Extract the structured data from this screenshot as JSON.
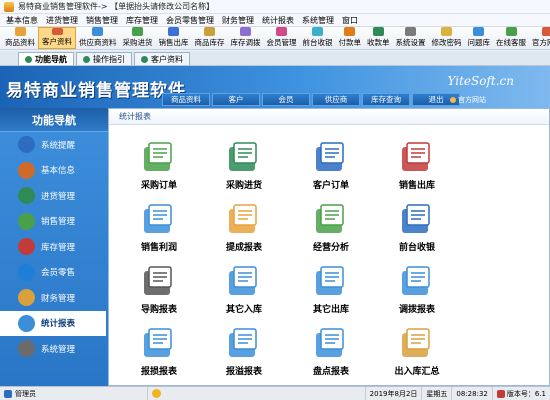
{
  "window": {
    "title": "易特商业销售管理软件-> 【单据抬头请修改公司名称】"
  },
  "menu": [
    "基本信息",
    "进货管理",
    "销售管理",
    "库存管理",
    "会员零售管理",
    "财务管理",
    "统计报表",
    "系统管理",
    "窗口"
  ],
  "toolbar": [
    {
      "label": "商品资料",
      "color": "#e9a23b"
    },
    {
      "label": "客户资料",
      "color": "#d95a3a",
      "active": true
    },
    {
      "label": "供应商资料",
      "color": "#3b8fd9"
    },
    {
      "label": "采购进货",
      "color": "#4aa04a"
    },
    {
      "label": "销售出库",
      "color": "#3b6fd9"
    },
    {
      "label": "商品库存",
      "color": "#c9a13b"
    },
    {
      "label": "库存调拨",
      "color": "#8a6fd0"
    },
    {
      "label": "会员管理",
      "color": "#d04a8a"
    },
    {
      "label": "前台收银",
      "color": "#3bb0c9"
    },
    {
      "label": "付款单",
      "color": "#e07b1a"
    },
    {
      "label": "收款单",
      "color": "#2e8b57"
    },
    {
      "label": "系统设置",
      "color": "#7a7a7a"
    },
    {
      "label": "修改密码",
      "color": "#d9b33b"
    },
    {
      "label": "问题库",
      "color": "#3b8fd9"
    },
    {
      "label": "在线客服",
      "color": "#4aa04a"
    },
    {
      "label": "官方网站",
      "color": "#d95a3a"
    },
    {
      "label": "锁定系",
      "color": "#6b6b6b"
    }
  ],
  "tabs": [
    {
      "label": "功能导航",
      "active": true
    },
    {
      "label": "操作指引"
    },
    {
      "label": "客户资料"
    }
  ],
  "banner": {
    "brand": "易特商业销售管理软件",
    "brand_tag": "YiteSoft.cn",
    "site_link": "官方网站",
    "nav": [
      "商品资料",
      "客户",
      "会员",
      "供应商",
      "库存查询",
      "退出"
    ]
  },
  "sidebar": {
    "header": "功能导航",
    "items": [
      {
        "label": "系统提醒",
        "icon": "info-icon",
        "color": "#2d6cc0"
      },
      {
        "label": "基本信息",
        "icon": "book-icon",
        "color": "#d06a2a"
      },
      {
        "label": "进货管理",
        "icon": "truck-icon",
        "color": "#2e8b57"
      },
      {
        "label": "销售管理",
        "icon": "sales-icon",
        "color": "#4aa04a"
      },
      {
        "label": "库存管理",
        "icon": "warehouse-icon",
        "color": "#c23a3a"
      },
      {
        "label": "会员零售",
        "icon": "member-icon",
        "color": "#1e7fd6"
      },
      {
        "label": "财务管理",
        "icon": "money-icon",
        "color": "#d9a03b"
      },
      {
        "label": "统计报表",
        "icon": "chart-icon",
        "color": "#3b8fd9",
        "active": true
      },
      {
        "label": "系统管理",
        "icon": "gear-icon",
        "color": "#6b6b6b"
      }
    ]
  },
  "content": {
    "breadcrumb": "统计报表",
    "reports": [
      {
        "label": "采购订单",
        "icon": "purchase-order-icon",
        "color": "#4aa04a"
      },
      {
        "label": "采购进货",
        "icon": "cart-icon",
        "color": "#2e8b57"
      },
      {
        "label": "客户订单",
        "icon": "customer-order-icon",
        "color": "#2d6cc0"
      },
      {
        "label": "销售出库",
        "icon": "sales-out-icon",
        "color": "#c23a3a"
      },
      {
        "label": "销售利润",
        "icon": "profit-icon",
        "color": "#3b8fd9"
      },
      {
        "label": "提成报表",
        "icon": "commission-icon",
        "color": "#e9a23b"
      },
      {
        "label": "经营分析",
        "icon": "analysis-icon",
        "color": "#4aa04a"
      },
      {
        "label": "前台收银",
        "icon": "cashier-icon",
        "color": "#2d6cc0"
      },
      {
        "label": "导购报表",
        "icon": "guide-icon",
        "color": "#555555"
      },
      {
        "label": "其它入库",
        "icon": "other-in-icon",
        "color": "#3b8fd9"
      },
      {
        "label": "其它出库",
        "icon": "other-out-icon",
        "color": "#3b8fd9"
      },
      {
        "label": "调拨报表",
        "icon": "transfer-icon",
        "color": "#3b8fd9"
      },
      {
        "label": "报损报表",
        "icon": "loss-icon",
        "color": "#3b8fd9"
      },
      {
        "label": "报溢报表",
        "icon": "overflow-icon",
        "color": "#3b8fd9"
      },
      {
        "label": "盘点报表",
        "icon": "inventory-icon",
        "color": "#3b8fd9"
      },
      {
        "label": "出入库汇总",
        "icon": "summary-icon",
        "color": "#d9a03b"
      }
    ]
  },
  "status": {
    "user_label": "管理员",
    "date": "2019年8月2日",
    "weekday": "星期五",
    "time": "08:28:32",
    "version": "版本号：6.1"
  }
}
